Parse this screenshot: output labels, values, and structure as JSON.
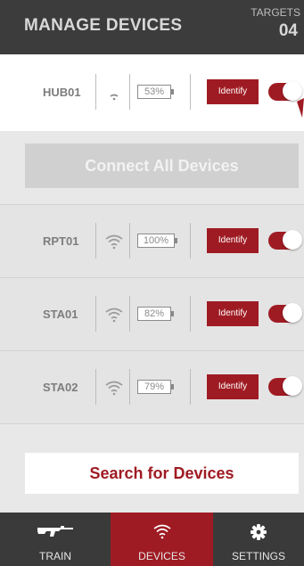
{
  "header": {
    "title": "MANAGE DEVICES",
    "targets_label": "TARGETS",
    "targets_count": "04"
  },
  "hub": {
    "name": "HUB01",
    "battery": "53%",
    "identify_label": "Identify",
    "toggle_on": true
  },
  "connect_all_label": "Connect All Devices",
  "devices": [
    {
      "name": "RPT01",
      "battery": "100%",
      "identify_label": "Identify",
      "toggle_on": true
    },
    {
      "name": "STA01",
      "battery": "82%",
      "identify_label": "Identify",
      "toggle_on": true
    },
    {
      "name": "STA02",
      "battery": "79%",
      "identify_label": "Identify",
      "toggle_on": true
    }
  ],
  "search_label": "Search for Devices",
  "tabs": [
    {
      "label": "TRAIN",
      "icon": "rifle-icon",
      "active": false
    },
    {
      "label": "DEVICES",
      "icon": "wifi-icon",
      "active": true
    },
    {
      "label": "SETTINGS",
      "icon": "gear-icon",
      "active": false
    }
  ],
  "colors": {
    "accent": "#9f1b23",
    "header_bg": "#3c3c3c",
    "tabbar_bg": "#3a3a3a"
  }
}
